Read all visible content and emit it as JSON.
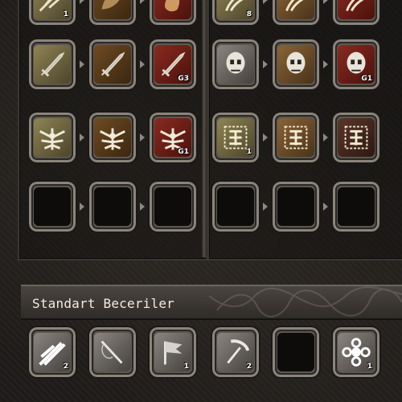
{
  "skill_tree": {
    "left_column": {
      "rows": [
        {
          "tiles": [
            {
              "icon": "feather-icon",
              "tone": "t-olive",
              "level": "1"
            },
            {
              "icon": "leaf-icon",
              "tone": "t-dark",
              "level": ""
            },
            {
              "icon": "flame-icon",
              "tone": "t-red",
              "level": ""
            }
          ]
        },
        {
          "tiles": [
            {
              "icon": "sword-icon",
              "tone": "t-olive",
              "level": ""
            },
            {
              "icon": "sword-icon",
              "tone": "t-dark",
              "level": ""
            },
            {
              "icon": "sword-icon",
              "tone": "t-red",
              "level": "G3"
            }
          ]
        },
        {
          "tiles": [
            {
              "icon": "winged-crest-icon",
              "tone": "t-olive",
              "level": ""
            },
            {
              "icon": "winged-crest-icon",
              "tone": "t-dark",
              "level": ""
            },
            {
              "icon": "winged-crest-icon",
              "tone": "t-red",
              "level": "G1"
            }
          ]
        },
        {
          "tiles": [
            {
              "icon": "empty-slot-icon",
              "tone": "t-empty",
              "level": ""
            },
            {
              "icon": "empty-slot-icon",
              "tone": "t-empty",
              "level": ""
            },
            {
              "icon": "empty-slot-icon",
              "tone": "t-empty",
              "level": ""
            }
          ]
        }
      ]
    },
    "right_column": {
      "rows": [
        {
          "tiles": [
            {
              "icon": "claw-icon",
              "tone": "t-olive",
              "level": "8"
            },
            {
              "icon": "claw-icon",
              "tone": "t-tan",
              "level": ""
            },
            {
              "icon": "claw-icon",
              "tone": "t-red",
              "level": ""
            }
          ]
        },
        {
          "tiles": [
            {
              "icon": "skull-mask-icon",
              "tone": "t-gray",
              "level": ""
            },
            {
              "icon": "skull-mask-icon",
              "tone": "t-tan",
              "level": ""
            },
            {
              "icon": "skull-mask-icon",
              "tone": "t-red",
              "level": "G1"
            }
          ]
        },
        {
          "tiles": [
            {
              "icon": "glyph-icon",
              "tone": "t-olive",
              "level": "1"
            },
            {
              "icon": "glyph-icon",
              "tone": "t-tan",
              "level": ""
            },
            {
              "icon": "glyph-icon",
              "tone": "t-maroon",
              "level": ""
            }
          ]
        },
        {
          "tiles": [
            {
              "icon": "empty-slot-icon",
              "tone": "t-empty",
              "level": ""
            },
            {
              "icon": "empty-slot-icon",
              "tone": "t-empty",
              "level": ""
            },
            {
              "icon": "empty-slot-icon",
              "tone": "t-empty",
              "level": ""
            }
          ]
        }
      ]
    }
  },
  "standard_skills": {
    "title": "Standart Beceriler",
    "tiles": [
      {
        "icon": "dash-icon",
        "tone": "t-gray",
        "level": "2"
      },
      {
        "icon": "fishing-rod-icon",
        "tone": "t-gray",
        "level": ""
      },
      {
        "icon": "flag-icon",
        "tone": "t-gray",
        "level": "1"
      },
      {
        "icon": "pickaxe-icon",
        "tone": "t-gray",
        "level": "2"
      },
      {
        "icon": "empty-slot-icon",
        "tone": "t-empty",
        "level": ""
      },
      {
        "icon": "flower-emblem-icon",
        "tone": "t-gray",
        "level": "1"
      }
    ]
  },
  "colors": {
    "panel_bg": "#1c1a18",
    "tile_frame": "#5c574f",
    "title_text": "#f2ede2"
  }
}
